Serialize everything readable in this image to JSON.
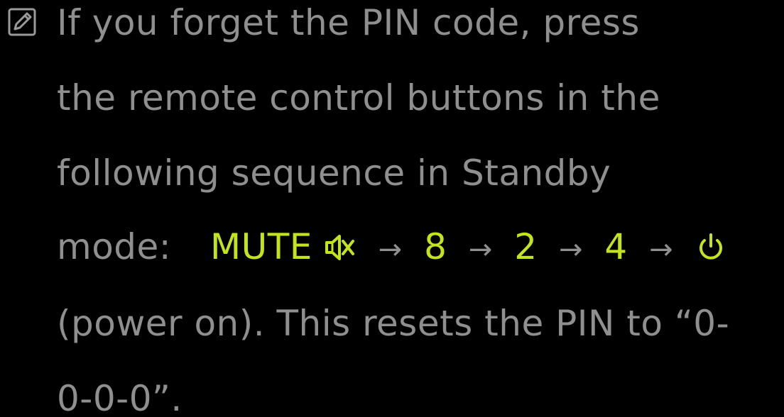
{
  "note": {
    "icon": "note-icon",
    "lines": [
      "If you forget the PIN code, press",
      "the remote control buttons in the",
      "following sequence in Standby"
    ],
    "mode_label": "mode:",
    "sequence": {
      "mute_label": "MUTE",
      "mute_icon": "mute-icon",
      "arrow": "→",
      "keys": [
        "8",
        "2",
        "4"
      ],
      "power_icon": "power-icon"
    },
    "line5": "(power on). This resets the PIN to “0-",
    "line6": "0-0-0”.",
    "accent_color": "#c3e31c",
    "text_color": "#8f8f8f"
  }
}
